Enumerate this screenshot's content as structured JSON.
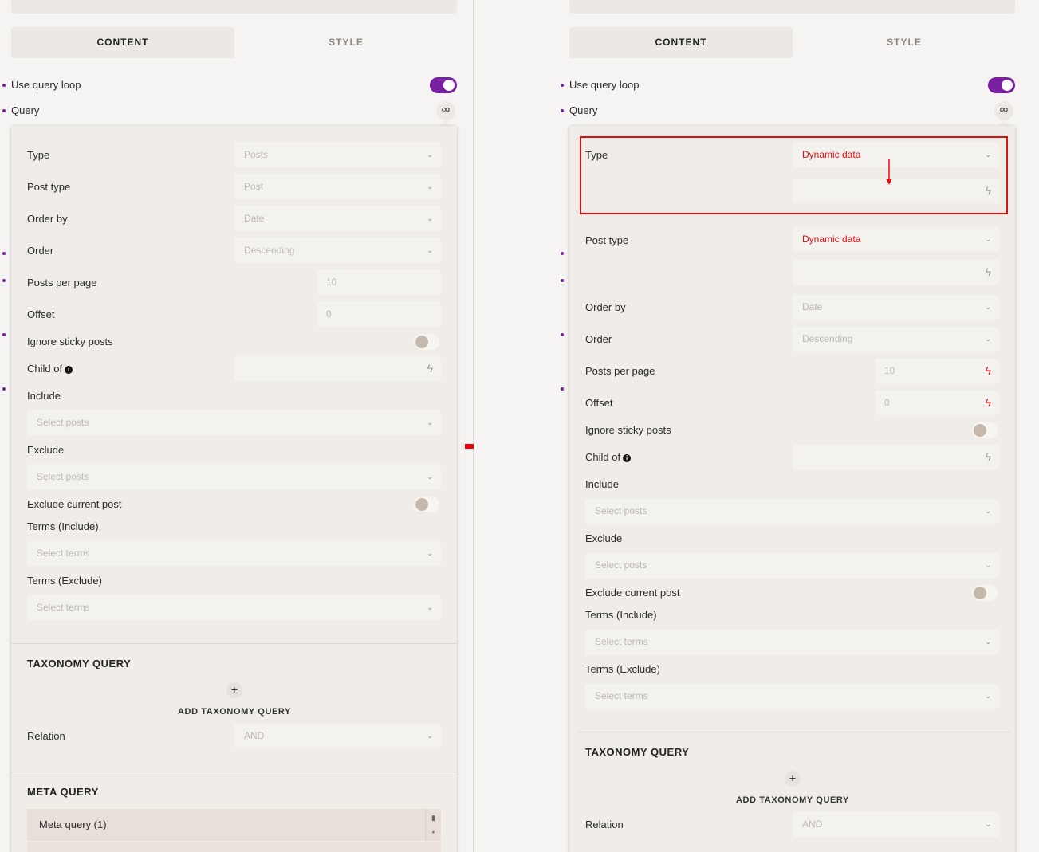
{
  "colors": {
    "accent": "#7b1fa2",
    "highlight_red": "#e01010",
    "panel_bg": "#f5f4f2",
    "popup_bg": "#f0ede9"
  },
  "left": {
    "element_id": "#brxe-zunsgx",
    "tabs": {
      "content": "CONTENT",
      "style": "STYLE"
    },
    "use_query_loop": "Use query loop",
    "query": "Query",
    "infinity_icon": "∞",
    "type_label": "Type",
    "type_value": "Posts",
    "post_type_label": "Post type",
    "post_type_value": "Post",
    "order_by_label": "Order by",
    "order_by_value": "Date",
    "order_label": "Order",
    "order_value": "Descending",
    "posts_per_page_label": "Posts per page",
    "posts_per_page_value": "10",
    "offset_label": "Offset",
    "offset_value": "0",
    "ignore_sticky_label": "Ignore sticky posts",
    "child_of_label": "Child of",
    "include_label": "Include",
    "include_placeholder": "Select posts",
    "exclude_label": "Exclude",
    "exclude_placeholder": "Select posts",
    "exclude_current_label": "Exclude current post",
    "terms_include_label": "Terms (Include)",
    "terms_include_placeholder": "Select terms",
    "terms_exclude_label": "Terms (Exclude)",
    "terms_exclude_placeholder": "Select terms",
    "taxonomy_title": "TAXONOMY QUERY",
    "add_taxonomy": "ADD TAXONOMY QUERY",
    "relation_label": "Relation",
    "relation_value": "AND",
    "meta_title": "META QUERY",
    "meta_item": "Meta query (1)"
  },
  "right": {
    "element_id": "#brxe-zunsgx",
    "tabs": {
      "content": "CONTENT",
      "style": "STYLE"
    },
    "use_query_loop": "Use query loop",
    "query": "Query",
    "infinity_icon": "∞",
    "type_label": "Type",
    "type_value": "Dynamic data",
    "post_type_label": "Post type",
    "post_type_value": "Dynamic data",
    "order_by_label": "Order by",
    "order_by_value": "Date",
    "order_label": "Order",
    "order_value": "Descending",
    "posts_per_page_label": "Posts per page",
    "posts_per_page_value": "10",
    "offset_label": "Offset",
    "offset_value": "0",
    "ignore_sticky_label": "Ignore sticky posts",
    "child_of_label": "Child of",
    "include_label": "Include",
    "include_placeholder": "Select posts",
    "exclude_label": "Exclude",
    "exclude_placeholder": "Select posts",
    "exclude_current_label": "Exclude current post",
    "terms_include_label": "Terms (Include)",
    "terms_include_placeholder": "Select terms",
    "terms_exclude_label": "Terms (Exclude)",
    "terms_exclude_placeholder": "Select terms",
    "taxonomy_title": "TAXONOMY QUERY",
    "add_taxonomy": "ADD TAXONOMY QUERY",
    "relation_label": "Relation",
    "relation_value": "AND"
  }
}
